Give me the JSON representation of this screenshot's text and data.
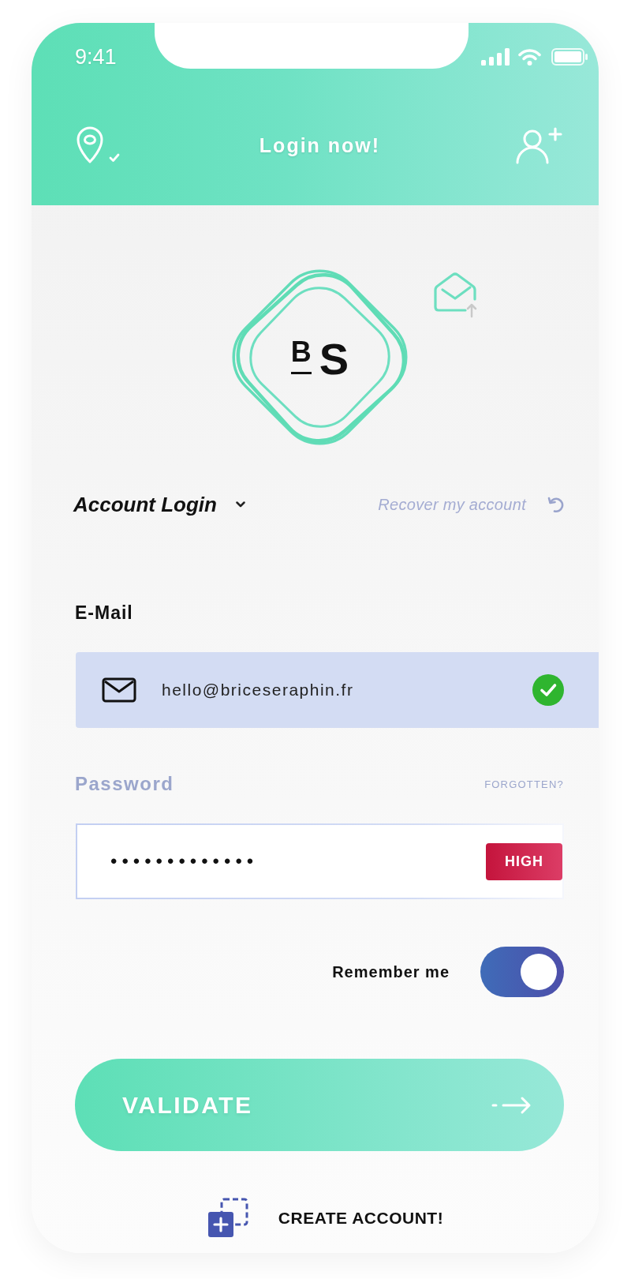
{
  "status_bar": {
    "time": "9:41"
  },
  "header": {
    "title": "Login now!"
  },
  "logo": {
    "mark": "B",
    "letter": "S"
  },
  "login_type": {
    "label": "Account Login"
  },
  "recover_link": {
    "label": "Recover my account"
  },
  "email": {
    "label": "E-Mail",
    "value": "hello@briceseraphin.fr",
    "valid": true
  },
  "password": {
    "label": "Password",
    "forgot_link": "FORGOTTEN?",
    "value": "•••••••••••••",
    "strength": "HIGH"
  },
  "remember_me": {
    "label": "Remember me",
    "on": true
  },
  "validate_button": {
    "label": "VALIDATE"
  },
  "create_account": {
    "label": "CREATE ACCOUNT!"
  }
}
